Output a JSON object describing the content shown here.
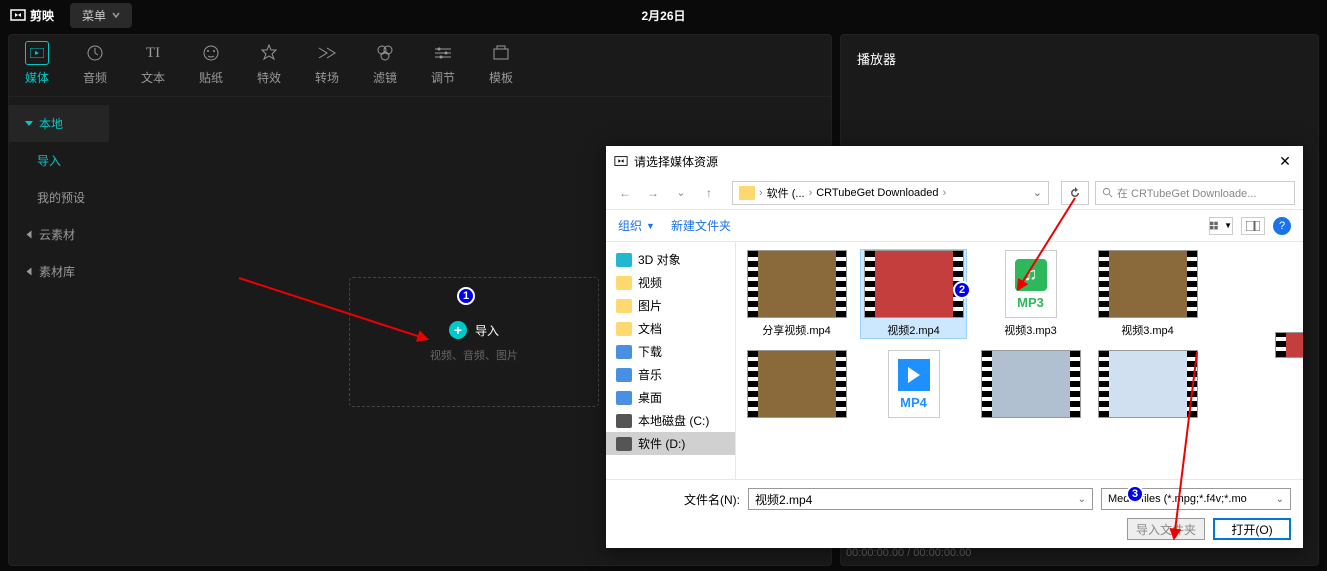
{
  "app": {
    "name": "剪映",
    "menu": "菜单",
    "date": "2月26日"
  },
  "toolbar": [
    {
      "label": "媒体",
      "active": true
    },
    {
      "label": "音频"
    },
    {
      "label": "文本"
    },
    {
      "label": "贴纸"
    },
    {
      "label": "特效"
    },
    {
      "label": "转场"
    },
    {
      "label": "滤镜"
    },
    {
      "label": "调节"
    },
    {
      "label": "模板"
    }
  ],
  "sidebar": {
    "local": "本地",
    "import": "导入",
    "presets": "我的预设",
    "cloud": "云素材",
    "library": "素材库"
  },
  "import": {
    "label": "导入",
    "hint": "视频、音频、图片"
  },
  "player": {
    "title": "播放器",
    "time": "00:00:00.00",
    "total": "00:00:00.00"
  },
  "dialog": {
    "title": "请选择媒体资源",
    "breadcrumb": {
      "a": "软件 (...",
      "b": "CRTubeGet Downloaded"
    },
    "search_placeholder": "在 CRTubeGet Downloade...",
    "organize": "组织",
    "new_folder": "新建文件夹",
    "sidebar": [
      {
        "label": "3D 对象",
        "cls": "cyan"
      },
      {
        "label": "视频",
        "cls": "folder"
      },
      {
        "label": "图片",
        "cls": "folder"
      },
      {
        "label": "文档",
        "cls": "folder"
      },
      {
        "label": "下载",
        "cls": "blue"
      },
      {
        "label": "音乐",
        "cls": "blue"
      },
      {
        "label": "桌面",
        "cls": "blue"
      },
      {
        "label": "本地磁盘 (C:)",
        "cls": "dark"
      },
      {
        "label": "软件 (D:)",
        "cls": "dark",
        "sel": true
      }
    ],
    "files": [
      {
        "name": "分享视频.mp4",
        "type": "video",
        "bg": "#8a6a3a"
      },
      {
        "name": "视频2.mp4",
        "type": "video",
        "bg": "#c43e3e",
        "sel": true
      },
      {
        "name": "视频3.mp3",
        "type": "mp3"
      },
      {
        "name": "视频3.mp4",
        "type": "video",
        "bg": "#8a6a3a"
      },
      {
        "name": "",
        "type": "video",
        "bg": "#8a6a3a"
      },
      {
        "name": "",
        "type": "mp4"
      },
      {
        "name": "",
        "type": "video",
        "bg": "#b0c0d0"
      },
      {
        "name": "",
        "type": "video",
        "bg": "#d0e0f0"
      }
    ],
    "filename_label": "文件名(N):",
    "filename_value": "视频2.mp4",
    "filter": "Media files (*.mpg;*.f4v;*.mo",
    "import_folder": "导入文件夹",
    "open": "打开(O)"
  },
  "badges": {
    "1": "1",
    "2": "2",
    "3": "3"
  }
}
